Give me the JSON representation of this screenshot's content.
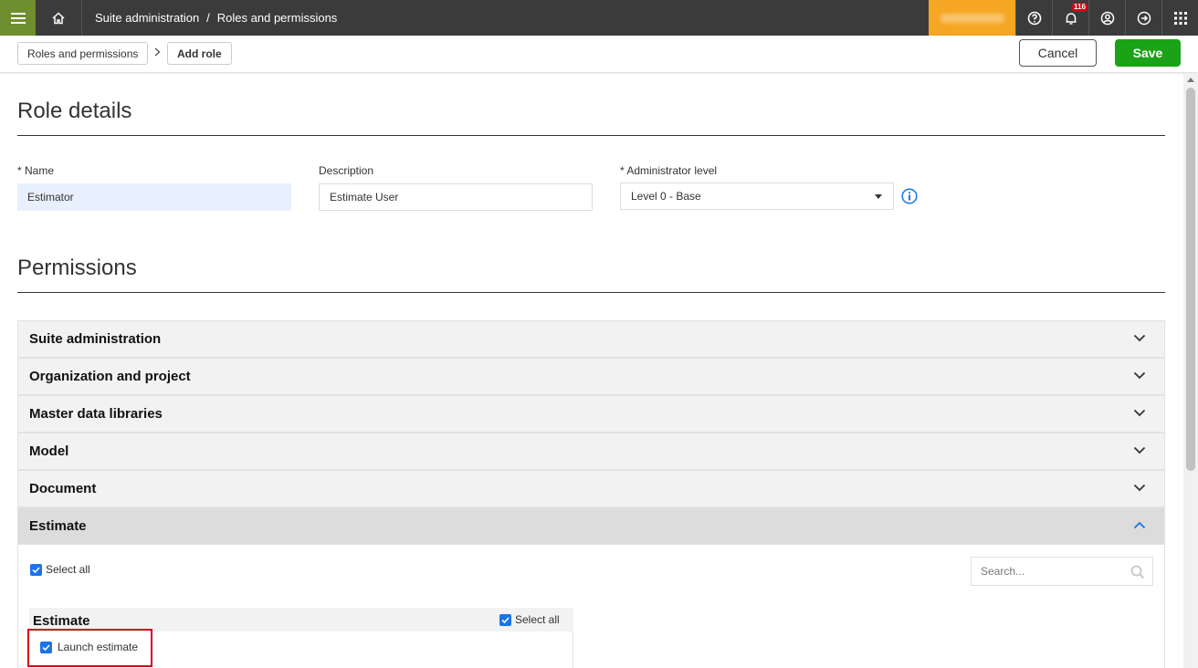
{
  "topbar": {
    "breadcrumb": [
      "Suite administration",
      "Roles and permissions"
    ],
    "notification_count": "116"
  },
  "subbar": {
    "breadcrumb": [
      "Roles and permissions",
      "Add role"
    ],
    "cancel_label": "Cancel",
    "save_label": "Save"
  },
  "role_details": {
    "title": "Role details",
    "name_label": "* Name",
    "name_value": "Estimator",
    "description_label": "Description",
    "description_value": "Estimate User",
    "admin_level_label": "* Administrator level",
    "admin_level_value": "Level 0 - Base"
  },
  "permissions": {
    "title": "Permissions",
    "sections": [
      "Suite administration",
      "Organization and project",
      "Master data libraries",
      "Model",
      "Document",
      "Estimate"
    ],
    "open_section": "Estimate",
    "select_all_label": "Select all",
    "search_placeholder": "Search...",
    "group": {
      "title": "Estimate",
      "select_all_label": "Select all",
      "items": [
        "Launch estimate"
      ]
    }
  },
  "colors": {
    "accent_green": "#1aa316",
    "menu_green": "#6f8e2f",
    "checkbox_blue": "#1a73e8",
    "highlight_red": "#d7001a",
    "info_blue": "#1a73e8"
  }
}
